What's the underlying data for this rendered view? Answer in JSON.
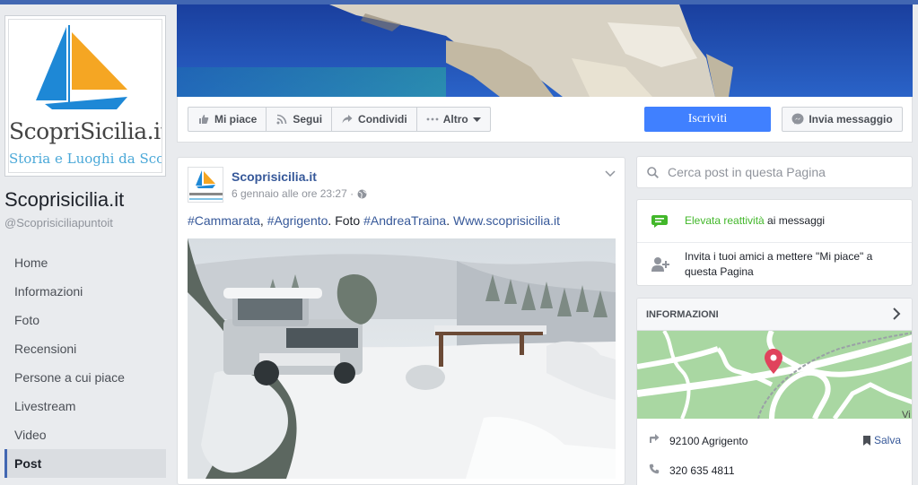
{
  "profile": {
    "logo_text": "ScopriSicilia.it",
    "logo_subtext": "Storia e Luoghi da Scoprire",
    "name": "Scoprisicilia.it",
    "handle": "@Scoprisiciliapuntoit"
  },
  "left_nav": [
    {
      "label": "Home"
    },
    {
      "label": "Informazioni"
    },
    {
      "label": "Foto"
    },
    {
      "label": "Recensioni"
    },
    {
      "label": "Persone a cui piace"
    },
    {
      "label": "Livestream"
    },
    {
      "label": "Video"
    },
    {
      "label": "Post",
      "active": true
    }
  ],
  "action_bar": {
    "like": "Mi piace",
    "follow": "Segui",
    "share": "Condividi",
    "more": "Altro",
    "subscribe": "Iscriviti",
    "message": "Invia messaggio"
  },
  "post": {
    "author": "Scoprisicilia.it",
    "timestamp": "6 gennaio alle ore 23:27 ·",
    "text_parts": {
      "tag1": "#Cammarata",
      "sep1": ", ",
      "tag2": "#Agrigento",
      "sep2": ". Foto ",
      "tag3": "#AndreaTraina",
      "sep3": ". ",
      "link": "Www.scoprisicilia.it"
    }
  },
  "sidebar": {
    "search_placeholder": "Cerca post in questa Pagina",
    "responsiveness_highlight": "Elevata reattività",
    "responsiveness_rest": " ai messaggi",
    "invite_text": "Invita i tuoi amici a mettere \"Mi piace\" a questa Pagina",
    "about_title": "INFORMAZIONI",
    "map_label": "Vi",
    "address": "92100 Agrigento",
    "save_label": "Salva",
    "phone": "320 635 4811"
  },
  "colors": {
    "brand_blue": "#4267b2",
    "primary_button": "#4080ff",
    "link": "#365899",
    "success_green": "#42b72a"
  }
}
